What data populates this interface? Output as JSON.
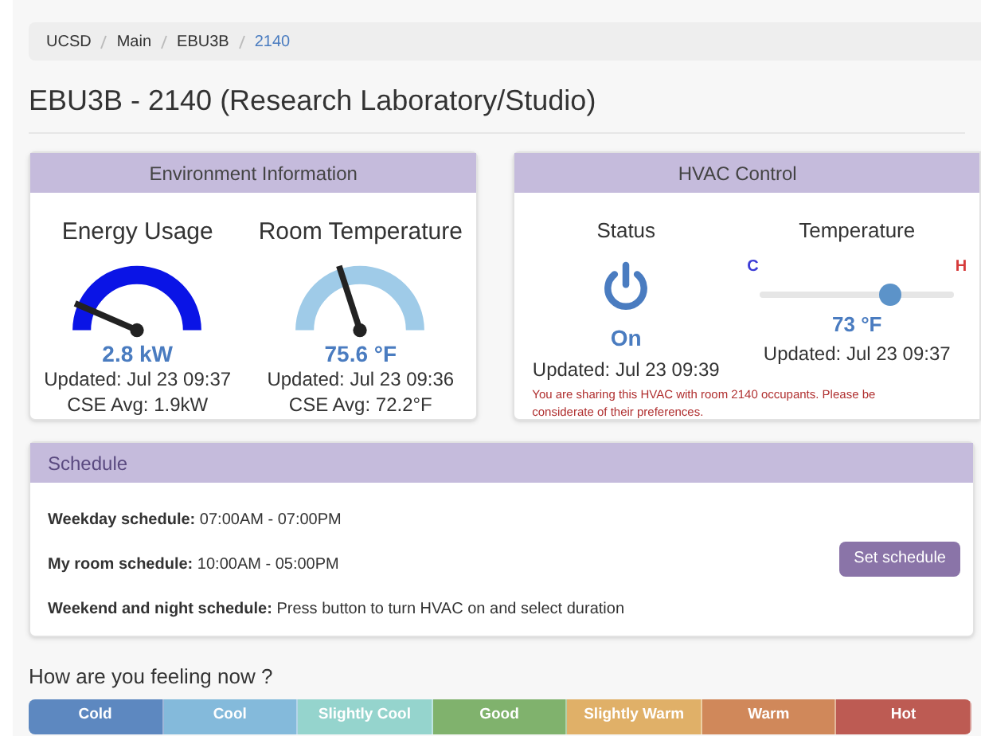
{
  "breadcrumb": [
    {
      "label": "UCSD",
      "current": false
    },
    {
      "label": "Main",
      "current": false
    },
    {
      "label": "EBU3B",
      "current": false
    },
    {
      "label": "2140",
      "current": true
    }
  ],
  "title": "EBU3B - 2140 (Research Laboratory/Studio)",
  "environment": {
    "title": "Environment Information",
    "gauges": [
      {
        "label": "Energy Usage",
        "color": "#0a14e6",
        "reading": "2.8 kW",
        "updated": "Updated: Jul 23 09:37",
        "average": "CSE Avg: 1.9kW"
      },
      {
        "label": "Room Temperature",
        "color": "#9fcbe8",
        "reading": "75.6 °F",
        "updated": "Updated: Jul 23 09:36",
        "average": "CSE Avg: 72.2°F"
      }
    ]
  },
  "hvac": {
    "title": "HVAC Control",
    "status_label": "Status",
    "on": true,
    "status": "On",
    "status_updated": "Updated: Jul 23 09:39",
    "temperature_label": "Temperature",
    "cold_mark": "C",
    "hot_mark": "H",
    "level": 0.67,
    "reading": "73 °F",
    "temperature_updated": "Updated: Jul 23 09:37",
    "notice": "You are sharing this HVAC with room 2140 occupants. Please be considerate of their preferences."
  },
  "schedule": {
    "title": "Schedule",
    "lines": [
      "**Weekday schedule:** 07:00AM - 07:00PM",
      "**My room schedule:** 10:00AM - 05:00PM",
      "**Weekend and night schedule:** Press button to turn HVAC on and select duration"
    ],
    "button": "Set schedule"
  },
  "feeling": {
    "question": "How are you feeling now ?",
    "options": [
      {
        "label": "Cold",
        "color": "#5d88c0"
      },
      {
        "label": "Cool",
        "color": "#84badb"
      },
      {
        "label": "Slightly Cool",
        "color": "#95d4cd"
      },
      {
        "label": "Good",
        "color": "#80b26d"
      },
      {
        "label": "Slightly Warm",
        "color": "#e0b068"
      },
      {
        "label": "Warm",
        "color": "#d0885a"
      },
      {
        "label": "Hot",
        "color": "#bd5b53"
      }
    ]
  }
}
